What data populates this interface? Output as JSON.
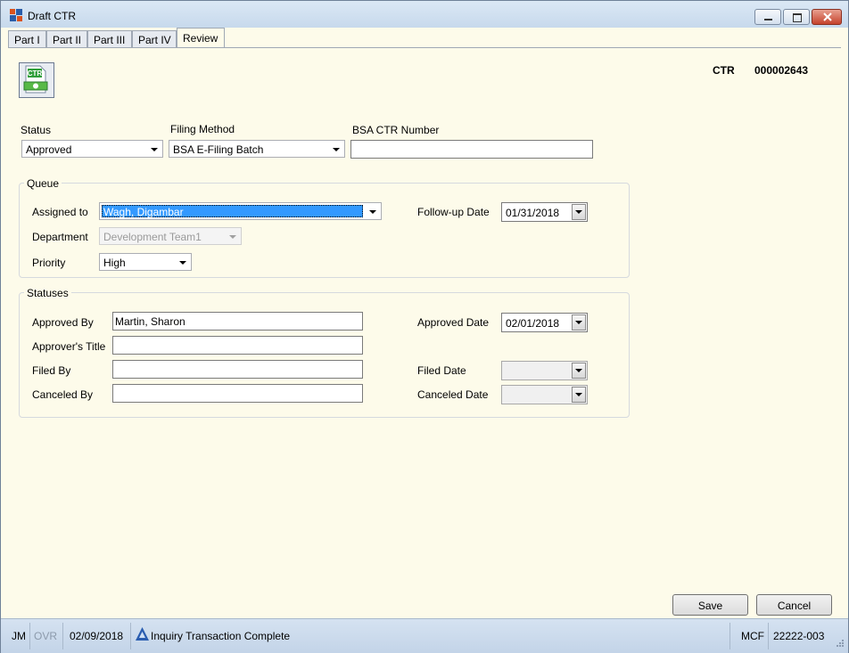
{
  "window": {
    "title": "Draft CTR"
  },
  "tabs": [
    {
      "label": "Part I"
    },
    {
      "label": "Part II"
    },
    {
      "label": "Part III"
    },
    {
      "label": "Part IV"
    },
    {
      "label": "Review",
      "active": true
    }
  ],
  "header": {
    "icon_label": "CTR",
    "ctr_label": "CTR",
    "ctr_number": "000002643"
  },
  "top": {
    "status_label": "Status",
    "status_value": "Approved",
    "filing_method_label": "Filing Method",
    "filing_method_value": "BSA E-Filing Batch",
    "bsa_ctr_number_label": "BSA CTR Number",
    "bsa_ctr_number_value": ""
  },
  "queue": {
    "title": "Queue",
    "assigned_to_label": "Assigned to",
    "assigned_to_value": "Wagh, Digambar",
    "department_label": "Department",
    "department_value": "Development Team1",
    "priority_label": "Priority",
    "priority_value": "High",
    "followup_date_label": "Follow-up Date",
    "followup_date_value": "01/31/2018"
  },
  "statuses": {
    "title": "Statuses",
    "approved_by_label": "Approved By",
    "approved_by_value": "Martin, Sharon",
    "approver_title_label": "Approver's Title",
    "approver_title_value": "",
    "filed_by_label": "Filed By",
    "filed_by_value": "",
    "canceled_by_label": "Canceled By",
    "canceled_by_value": "",
    "approved_date_label": "Approved Date",
    "approved_date_value": "02/01/2018",
    "filed_date_label": "Filed Date",
    "filed_date_value": "",
    "canceled_date_label": "Canceled Date",
    "canceled_date_value": ""
  },
  "buttons": {
    "save": "Save",
    "cancel": "Cancel"
  },
  "statusbar": {
    "user": "JM",
    "ovr": "OVR",
    "date": "02/09/2018",
    "message": "Inquiry Transaction Complete",
    "app": "MCF",
    "code": "22222-003"
  },
  "colors": {
    "background": "#fdfbea",
    "selection": "#3399ff",
    "statusbar": "#c8d7e8"
  }
}
